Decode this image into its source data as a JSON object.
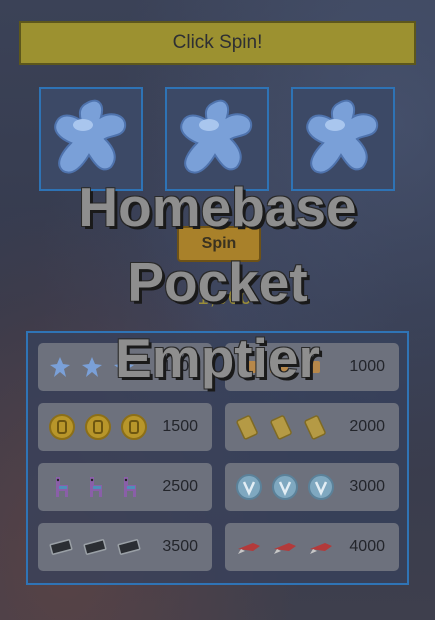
{
  "banner": {
    "label": "Click Spin!"
  },
  "reels": [
    {
      "symbol": "blue-star-icon"
    },
    {
      "symbol": "blue-star-icon"
    },
    {
      "symbol": "blue-star-icon"
    }
  ],
  "spin_button": {
    "label": "Spin"
  },
  "balance": {
    "value": "1,000"
  },
  "overlay_title": {
    "line1": "Homebase",
    "line2": "Pocket",
    "line3": "Emptier"
  },
  "paytable": [
    {
      "symbol": "blue-star-icon",
      "payout": "1000"
    },
    {
      "symbol": "ticket-icon",
      "payout": "1000"
    },
    {
      "symbol": "gold-coin-icon",
      "payout": "1500"
    },
    {
      "symbol": "gold-ticket-icon",
      "payout": "2000"
    },
    {
      "symbol": "llama-icon",
      "payout": "2500"
    },
    {
      "symbol": "vbuck-icon",
      "payout": "3000"
    },
    {
      "symbol": "cash-icon",
      "payout": "3500"
    },
    {
      "symbol": "rocket-icon",
      "payout": "4000"
    }
  ],
  "colors": {
    "accent": "#9c9130",
    "border": "#2f74b6",
    "panel": "#6d717d"
  }
}
